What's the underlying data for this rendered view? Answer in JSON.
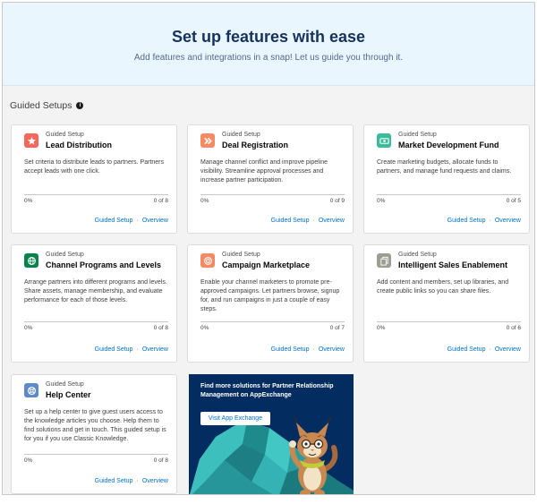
{
  "hero": {
    "title": "Set up features with ease",
    "subtitle": "Add features and integrations in a snap! Let us guide you through it."
  },
  "section": {
    "title": "Guided Setups",
    "info_icon": "i"
  },
  "cards": [
    {
      "eyebrow": "Guided Setup",
      "title": "Lead Distribution",
      "icon": "star-icon",
      "color": "#f5675b",
      "description": "Set criteria to distribute leads to partners. Partners accept leads with one click.",
      "progress_percent": "0%",
      "progress_count": "0 of 8",
      "progress_value": 0,
      "link_setup": "Guided Setup",
      "link_overview": "Overview"
    },
    {
      "eyebrow": "Guided Setup",
      "title": "Deal Registration",
      "icon": "double-chevron-icon",
      "color": "#f88962",
      "description": "Manage channel conflict and improve pipeline visibility. Streamline approval processes and increase partner participation.",
      "progress_percent": "0%",
      "progress_count": "0 of 9",
      "progress_value": 0,
      "link_setup": "Guided Setup",
      "link_overview": "Overview"
    },
    {
      "eyebrow": "Guided Setup",
      "title": "Market Development Fund",
      "icon": "money-icon",
      "color": "#3bba9c",
      "description": "Create marketing budgets, allocate funds to partners, and manage fund requests and claims.",
      "progress_percent": "0%",
      "progress_count": "0 of 5",
      "progress_value": 0,
      "link_setup": "Guided Setup",
      "link_overview": "Overview"
    },
    {
      "eyebrow": "Guided Setup",
      "title": "Channel Programs and Levels",
      "icon": "globe-icon",
      "color": "#04844b",
      "description": "Arrange partners into different programs and levels. Share assets, manage membership, and evaluate performance for each of those levels.",
      "progress_percent": "0%",
      "progress_count": "0 of 8",
      "progress_value": 0,
      "link_setup": "Guided Setup",
      "link_overview": "Overview"
    },
    {
      "eyebrow": "Guided Setup",
      "title": "Campaign Marketplace",
      "icon": "target-icon",
      "color": "#f88962",
      "description": "Enable your channel marketers to promote pre-approved campaigns. Let partners browse, signup for, and run campaigns in just a couple of easy steps.",
      "progress_percent": "0%",
      "progress_count": "0 of 7",
      "progress_value": 0,
      "link_setup": "Guided Setup",
      "link_overview": "Overview"
    },
    {
      "eyebrow": "Guided Setup",
      "title": "Intelligent Sales Enablement",
      "icon": "documents-icon",
      "color": "#9e9d91",
      "description": "Add content and members, set up libraries, and create public links so you can share files.",
      "progress_percent": "0%",
      "progress_count": "0 of 6",
      "progress_value": 0,
      "link_setup": "Guided Setup",
      "link_overview": "Overview"
    },
    {
      "eyebrow": "Guided Setup",
      "title": "Help Center",
      "icon": "lifebuoy-icon",
      "color": "#5e8ac6",
      "description": "Set up a help center to give guest users access to the knowledge articles you choose. Help them to find solutions and get in touch. This guided setup is for you if you use Classic Knowledge.",
      "progress_percent": "0%",
      "progress_count": "0 of 8",
      "progress_value": 0,
      "link_setup": "Guided Setup",
      "link_overview": "Overview"
    }
  ],
  "promo": {
    "text": "Find more solutions for Partner Relationship Management on AppExchange",
    "button": "Visit App Exchange",
    "background": "#032d60",
    "mascot": "bobcat-mascot-illustration"
  }
}
